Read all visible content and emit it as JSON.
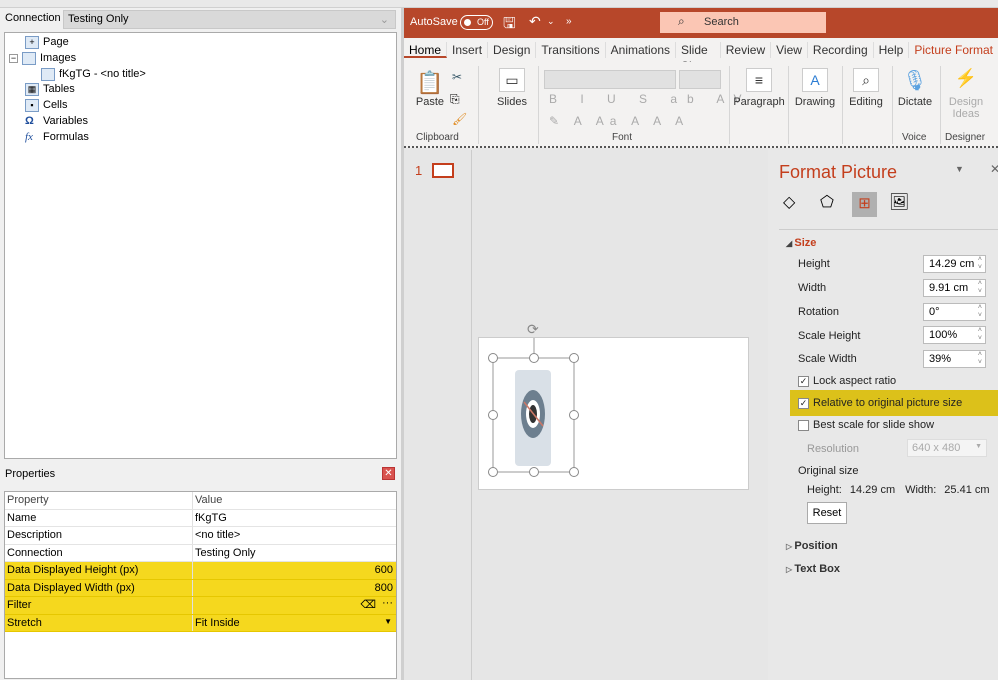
{
  "left": {
    "connection_label": "Connection",
    "connection_value": "Testing Only",
    "tree": [
      {
        "label": "Page",
        "icon": "page-icon"
      },
      {
        "label": "Images",
        "icon": "images-icon"
      },
      {
        "label": "fKgTG - <no title>",
        "icon": "image-icon"
      },
      {
        "label": "Tables",
        "icon": "table-icon"
      },
      {
        "label": "Cells",
        "icon": "cells-icon"
      },
      {
        "label": "Variables",
        "icon": "omega-icon"
      },
      {
        "label": "Formulas",
        "icon": "fx-icon"
      }
    ],
    "properties_title": "Properties",
    "table_headers": [
      "Property",
      "Value"
    ],
    "rows": [
      [
        "Name",
        "fKgTG"
      ],
      [
        "Description",
        "<no title>"
      ],
      [
        "Connection",
        "Testing Only"
      ],
      [
        "Data Displayed Height (px)",
        "600"
      ],
      [
        "Data Displayed Width (px)",
        "800"
      ],
      [
        "Filter",
        ""
      ],
      [
        "Stretch",
        "Fit Inside"
      ]
    ],
    "highlight_color": "#f5d81e"
  },
  "ppt": {
    "autosave": "AutoSave",
    "autosave_state": "Off",
    "search": "Search",
    "tabs": [
      "Home",
      "Insert",
      "Design",
      "Transitions",
      "Animations",
      "Slide Show",
      "Review",
      "View",
      "Recording",
      "Help",
      "Picture Format"
    ],
    "ribbon": {
      "paste": "Paste",
      "slides": "Slides",
      "paragraph": "Paragraph",
      "drawing": "Drawing",
      "editing": "Editing",
      "dictate": "Dictate",
      "design_ideas": "Design Ideas",
      "clipboard": "Clipboard",
      "font": "Font",
      "voice": "Voice",
      "designer": "Designer"
    },
    "slide_number": "1",
    "accent": "#b7472a"
  },
  "format": {
    "title": "Format Picture",
    "section": "Size",
    "fields": [
      {
        "label": "Height",
        "value": "14.29 cm"
      },
      {
        "label": "Width",
        "value": "9.91 cm"
      },
      {
        "label": "Rotation",
        "value": "0°"
      },
      {
        "label": "Scale Height",
        "value": "100%"
      },
      {
        "label": "Scale Width",
        "value": "39%"
      }
    ],
    "lock_aspect": "Lock aspect ratio",
    "relative": "Relative to original picture size",
    "best_scale": "Best scale for slide show",
    "resolution_label": "Resolution",
    "resolution_value": "640 x 480",
    "original_size": "Original size",
    "orig_height_label": "Height:",
    "orig_height": "14.29 cm",
    "orig_width_label": "Width:",
    "orig_width": "25.41 cm",
    "reset": "Reset",
    "position": "Position",
    "textbox": "Text Box",
    "highlight_color": "#dcc11a"
  }
}
